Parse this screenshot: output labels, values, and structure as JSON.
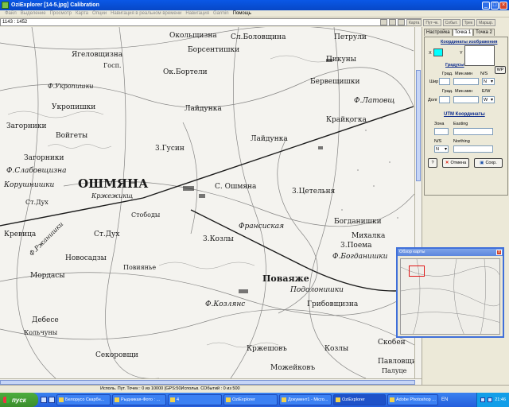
{
  "window": {
    "title": "OziExplorer [14-5.jpg] Calibration"
  },
  "menu": [
    {
      "label": "Файл",
      "active": false
    },
    {
      "label": "Выделение",
      "active": false
    },
    {
      "label": "Просмотр",
      "active": false
    },
    {
      "label": "Карта",
      "active": false
    },
    {
      "label": "Опции",
      "active": false
    },
    {
      "label": "Навигация в реальном времени",
      "active": false
    },
    {
      "label": "Навигация",
      "active": false
    },
    {
      "label": "Garmin",
      "active": false
    },
    {
      "label": "Помощь",
      "active": true
    }
  ],
  "coords": "1143 : 1452",
  "right_tabs": [
    "Карта",
    "Пут-чк.",
    "Событ.",
    "Трек",
    "Маршр."
  ],
  "panel": {
    "tabs": [
      "Настройка",
      "Точка 1",
      "Точка 2"
    ],
    "image_coords_title": "Координаты изображения",
    "x_label": "X",
    "y_label": "Y",
    "geo_title": "Градусы",
    "grad_label": "Град.",
    "min_label": "Мин.мин",
    "ns_label": "N/S",
    "ew_label": "E/W",
    "lat_label": "Шир",
    "lon_label": "Долг",
    "ns_value": "N",
    "ew_value": "W",
    "wp_label": "WP",
    "utm_title": "UTM Координаты",
    "zone_label": "Зона",
    "easting_label": "Easting",
    "utm_ns_label": "N/S",
    "northing_label": "Northing",
    "utm_ns_value": "N",
    "help_label": "?",
    "cancel_label": "Отмена",
    "save_label": "Сохр."
  },
  "overview": {
    "title": "Обзор карты",
    "close": "x"
  },
  "map_labels": [
    {
      "text": "Окольщизна"
    },
    {
      "text": "Сл.Боловщина"
    },
    {
      "text": "Петрули"
    },
    {
      "text": "Ягеловщизна"
    },
    {
      "text": "Борсентишки"
    },
    {
      "text": "Госп."
    },
    {
      "text": "Пикуны"
    },
    {
      "text": "Ф.Укропишки"
    },
    {
      "text": "Ок.Бортели"
    },
    {
      "text": "Бервещишки"
    },
    {
      "text": "Укропишки"
    },
    {
      "text": "Ф.Латовщ"
    },
    {
      "text": "Загорники"
    },
    {
      "text": "Лайдунка"
    },
    {
      "text": "Крайкогка"
    },
    {
      "text": "Войгеты"
    },
    {
      "text": "3.Гусин"
    },
    {
      "text": "Лайдунка"
    },
    {
      "text": "Загорники"
    },
    {
      "text": "Ф.Слабовщизна"
    },
    {
      "text": "Корушнишки"
    },
    {
      "text": "ОШМЯНА"
    },
    {
      "text": "Кржежикщ"
    },
    {
      "text": "С. Ошмяна"
    },
    {
      "text": "3.Цетельня"
    },
    {
      "text": "Ст.Дух"
    },
    {
      "text": "Стободы"
    },
    {
      "text": "Ф.Ржанишки"
    },
    {
      "text": "Ст.Дух"
    },
    {
      "text": "Франсиская"
    },
    {
      "text": "Богданишки"
    },
    {
      "text": "3.Козлы"
    },
    {
      "text": "Михалка"
    },
    {
      "text": "Кревица"
    },
    {
      "text": "3.Поема"
    },
    {
      "text": "Новосадзы"
    },
    {
      "text": "Повиянье"
    },
    {
      "text": "Ф.Богданишки"
    },
    {
      "text": "Поваяже"
    },
    {
      "text": "Подолонишки"
    },
    {
      "text": "Мордасы"
    },
    {
      "text": "Ф.Козлянс"
    },
    {
      "text": "Грибовщизна"
    },
    {
      "text": "Дебесе"
    },
    {
      "text": "Кольчуны"
    },
    {
      "text": "Кржешовъ"
    },
    {
      "text": "Козлы"
    },
    {
      "text": "Скобен"
    },
    {
      "text": "Секоровщи"
    },
    {
      "text": "Можейковъ"
    },
    {
      "text": "Павловщи"
    },
    {
      "text": "Палуце"
    }
  ],
  "status": "Исполь. Пут. Точек : 0 из 10000  [GPS:50Испольв. СОбытий : 0 из 500",
  "taskbar": {
    "start": "пуск",
    "tasks": [
      {
        "label": "Белорусо Скарбн...",
        "active": false
      },
      {
        "label": "Рыдникая-Фото : ...",
        "active": false
      },
      {
        "label": "4",
        "active": false
      },
      {
        "label": "OziExplorer",
        "active": false
      },
      {
        "label": "Документ1 - Micro...",
        "active": false
      },
      {
        "label": "OziExplorer",
        "active": true
      },
      {
        "label": "Adobe Photoshop ...",
        "active": false
      }
    ],
    "lang": "EN",
    "clock": "21:46"
  }
}
